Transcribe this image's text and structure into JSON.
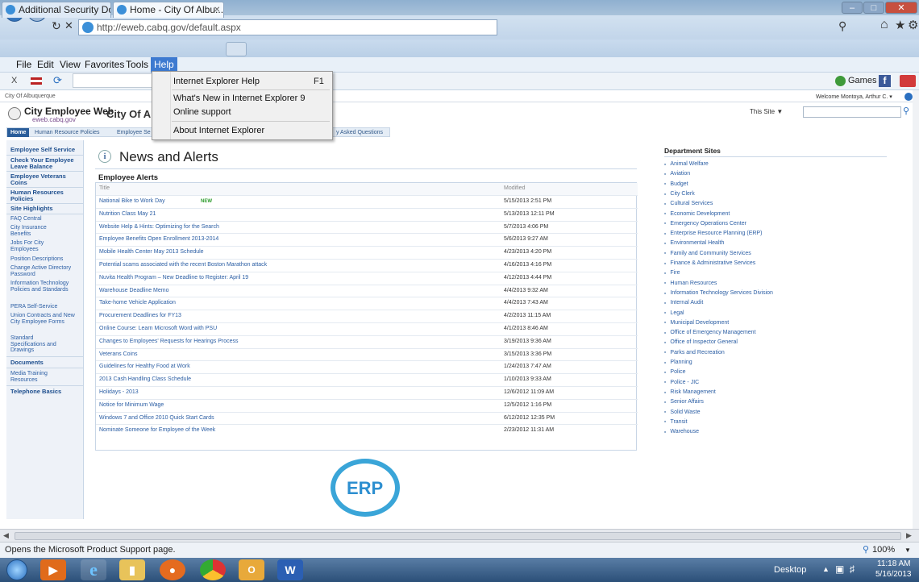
{
  "browser": {
    "address": "http://eweb.cabq.gov/default.aspx",
    "tabs": [
      {
        "label": "Additional Security Do..."
      },
      {
        "label": "Home - City Of Albu..."
      }
    ],
    "menus": [
      "File",
      "Edit",
      "View",
      "Favorites",
      "Tools",
      "Help"
    ],
    "help_menu": {
      "items": [
        {
          "label": "Internet Explorer Help",
          "shortcut": "F1"
        },
        {
          "label": "What's New in Internet Explorer 9",
          "shortcut": ""
        },
        {
          "label": "Online support",
          "shortcut": ""
        },
        {
          "label": "About Internet Explorer",
          "shortcut": ""
        }
      ]
    },
    "cmd_x": "X",
    "games_label": "Games",
    "status_text": "Opens the Microsoft Product Support page.",
    "zoom": "100%"
  },
  "page": {
    "breadcrumb": "City Of Albuquerque",
    "welcome": "Welcome Montoya, Arthur C. ▾",
    "logo_title": "City Employee Web",
    "logo_sub": "eweb.cabq.gov",
    "site_title": "City Of All",
    "search_scope": "This Site",
    "top_tabs": [
      "Home",
      "Human Resource Policies",
      "Employee Se",
      "y Asked Questions"
    ],
    "left_nav": {
      "sections": [
        {
          "heading": "Employee Self Service",
          "items": []
        },
        {
          "heading": "Check Your Employee Leave Balance",
          "items": []
        },
        {
          "heading": "Employee Veterans Coins",
          "items": []
        },
        {
          "heading": "Human Resources Policies",
          "items": []
        },
        {
          "heading": "Site Highlights",
          "items": [
            "FAQ Central",
            "City Insurance Benefits",
            "Jobs For City Employees",
            "Position Descriptions",
            "Change Active Directory Password",
            "Information Technology Policies and Standards",
            "PERA Self-Service",
            "Union Contracts and New City Employee Forms",
            "Standard Specifications and Drawings"
          ]
        },
        {
          "heading": "Documents",
          "items": [
            "Media Training Resources"
          ]
        },
        {
          "heading": "Telephone Basics",
          "items": []
        }
      ]
    },
    "news_title": "News and Alerts",
    "alerts_heading": "Employee Alerts",
    "col_title": "Title",
    "col_modified": "Modified",
    "new_badge": "NEW",
    "alerts": [
      {
        "title": "National Bike to Work Day",
        "modified": "5/15/2013 2:51 PM",
        "is_new": true
      },
      {
        "title": "Nutrition Class May 21",
        "modified": "5/13/2013 12:11 PM"
      },
      {
        "title": "Website Help & Hints: Optimizing for the Search",
        "modified": "5/7/2013 4:06 PM"
      },
      {
        "title": "Employee Benefits Open Enrollment 2013-2014",
        "modified": "5/6/2013 9:27 AM"
      },
      {
        "title": "Mobile Health Center May 2013 Schedule",
        "modified": "4/23/2013 4:20 PM"
      },
      {
        "title": "Potential scams associated with the recent Boston Marathon attack",
        "modified": "4/16/2013 4:16 PM"
      },
      {
        "title": "Nuvita Health Program – New Deadline to Register: April 19",
        "modified": "4/12/2013 4:44 PM"
      },
      {
        "title": "Warehouse Deadline Memo",
        "modified": "4/4/2013 9:32 AM"
      },
      {
        "title": "Take-home Vehicle Application",
        "modified": "4/4/2013 7:43 AM"
      },
      {
        "title": "Procurement Deadlines for FY13",
        "modified": "4/2/2013 11:15 AM"
      },
      {
        "title": "Online Course: Learn Microsoft Word with PSU",
        "modified": "4/1/2013 8:46 AM"
      },
      {
        "title": "Changes to Employees' Requests for Hearings Process",
        "modified": "3/19/2013 9:36 AM"
      },
      {
        "title": "Veterans Coins",
        "modified": "3/15/2013 3:36 PM"
      },
      {
        "title": "Guidelines for Healthy Food at Work",
        "modified": "1/24/2013 7:47 AM"
      },
      {
        "title": "2013 Cash Handling Class Schedule",
        "modified": "1/10/2013 9:33 AM"
      },
      {
        "title": "Holidays - 2013",
        "modified": "12/6/2012 11:09 AM"
      },
      {
        "title": "Notice for Minimum Wage",
        "modified": "12/5/2012 1:16 PM"
      },
      {
        "title": "Windows 7 and Office 2010 Quick Start Cards",
        "modified": "6/12/2012 12:35 PM"
      },
      {
        "title": "Nominate Someone for Employee of the Week",
        "modified": "2/23/2012 11:31 AM"
      }
    ],
    "erp_logo": "ERP",
    "dept_heading": "Department Sites",
    "departments": [
      "Animal Welfare",
      "Aviation",
      "Budget",
      "City Clerk",
      "Cultural Services",
      "Economic Development",
      "Emergency Operations Center",
      "Enterprise Resource Planning (ERP)",
      "Environmental Health",
      "Family and Community Services",
      "Finance & Administrative Services",
      "Fire",
      "Human Resources",
      "Information Technology Services Division",
      "Internal Audit",
      "Legal",
      "Municipal Development",
      "Office of Emergency Management",
      "Office of Inspector General",
      "Parks and Recreation",
      "Planning",
      "Police",
      "Police - JIC",
      "Risk Management",
      "Senior Affairs",
      "Solid Waste",
      "Transit",
      "Warehouse"
    ]
  },
  "taskbar": {
    "desktop_label": "Desktop",
    "time": "11:18 AM",
    "date": "5/16/2013"
  },
  "colors": {
    "accent": "#3d7ad0",
    "link": "#2b5ea4",
    "nav_heading": "#1e4f8e"
  }
}
